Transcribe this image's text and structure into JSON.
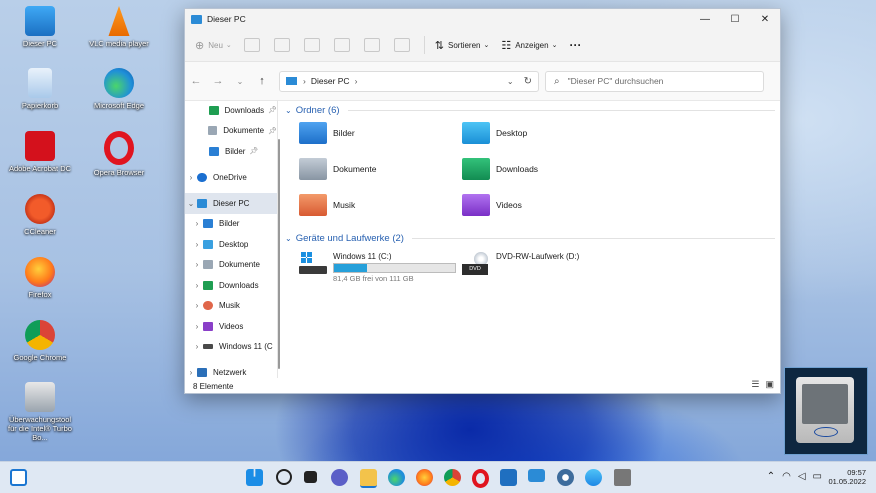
{
  "desktop": {
    "icons": [
      {
        "label": "Dieser PC"
      },
      {
        "label": "VLC media player"
      },
      {
        "label": "Papierkorb"
      },
      {
        "label": "Microsoft Edge"
      },
      {
        "label": "Adobe Acrobat DC"
      },
      {
        "label": "Opera Browser"
      },
      {
        "label": "CCleaner"
      },
      {
        "label": "Firefox"
      },
      {
        "label": "Google Chrome"
      },
      {
        "label": "Überwachungstool für die Intel® Turbo Bo..."
      }
    ]
  },
  "window": {
    "title": "Dieser PC",
    "controls": {
      "minimize": "—",
      "maximize": "☐",
      "close": "✕"
    },
    "toolbar": {
      "new_label": "Neu",
      "sort_label": "Sortieren",
      "view_label": "Anzeigen",
      "more_label": "···"
    },
    "address": {
      "breadcrumb": "Dieser PC"
    },
    "search": {
      "placeholder": "\"Dieser PC\" durchsuchen"
    },
    "sidebar": {
      "items": [
        {
          "label": "Downloads"
        },
        {
          "label": "Dokumente"
        },
        {
          "label": "Bilder"
        },
        {
          "label": "OneDrive"
        },
        {
          "label": "Dieser PC"
        },
        {
          "label": "Bilder"
        },
        {
          "label": "Desktop"
        },
        {
          "label": "Dokumente"
        },
        {
          "label": "Downloads"
        },
        {
          "label": "Musik"
        },
        {
          "label": "Videos"
        },
        {
          "label": "Windows 11 (C"
        },
        {
          "label": "Netzwerk"
        }
      ]
    },
    "folders_header": "Ordner (6)",
    "folders": [
      {
        "name": "Bilder"
      },
      {
        "name": "Desktop"
      },
      {
        "name": "Dokumente"
      },
      {
        "name": "Downloads"
      },
      {
        "name": "Musik"
      },
      {
        "name": "Videos"
      }
    ],
    "drives_header": "Geräte und Laufwerke (2)",
    "drives": [
      {
        "name": "Windows 11 (C:)",
        "free_text": "81,4 GB frei von 111 GB",
        "used_fraction": 0.27
      },
      {
        "name": "DVD-RW-Laufwerk (D:)",
        "badge": "DVD"
      }
    ],
    "status": "8 Elemente"
  },
  "taskbar": {
    "time": "09:57",
    "date": "01.05.2022"
  }
}
